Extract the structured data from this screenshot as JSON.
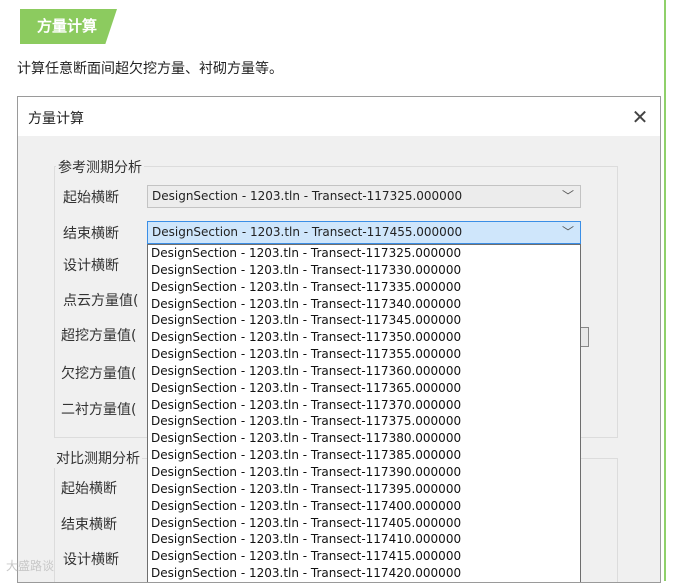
{
  "section_tag": "方量计算",
  "intro": "计算任意断面间超欠挖方量、衬砌方量等。",
  "dialog": {
    "title": "方量计算",
    "close_glyph": "✕",
    "ref_group": {
      "title": "参考测期分析",
      "labels": [
        "起始横断",
        "结束横断",
        "设计横断",
        "点云方量值(",
        "超挖方量值(",
        "欠挖方量值(",
        "二衬方量值("
      ],
      "start_value": "DesignSection - 1203.tln - Transect-117325.000000",
      "end_value": "DesignSection - 1203.tln - Transect-117455.000000"
    },
    "cmp_group": {
      "title": "对比测期分析",
      "labels": [
        "起始横断",
        "结束横断",
        "设计横断"
      ]
    },
    "dropdown_items": [
      "DesignSection - 1203.tln - Transect-117325.000000",
      "DesignSection - 1203.tln - Transect-117330.000000",
      "DesignSection - 1203.tln - Transect-117335.000000",
      "DesignSection - 1203.tln - Transect-117340.000000",
      "DesignSection - 1203.tln - Transect-117345.000000",
      "DesignSection - 1203.tln - Transect-117350.000000",
      "DesignSection - 1203.tln - Transect-117355.000000",
      "DesignSection - 1203.tln - Transect-117360.000000",
      "DesignSection - 1203.tln - Transect-117365.000000",
      "DesignSection - 1203.tln - Transect-117370.000000",
      "DesignSection - 1203.tln - Transect-117375.000000",
      "DesignSection - 1203.tln - Transect-117380.000000",
      "DesignSection - 1203.tln - Transect-117385.000000",
      "DesignSection - 1203.tln - Transect-117390.000000",
      "DesignSection - 1203.tln - Transect-117395.000000",
      "DesignSection - 1203.tln - Transect-117400.000000",
      "DesignSection - 1203.tln - Transect-117405.000000",
      "DesignSection - 1203.tln - Transect-117410.000000",
      "DesignSection - 1203.tln - Transect-117415.000000",
      "DesignSection - 1203.tln - Transect-117420.000000"
    ]
  },
  "watermark": "大盛路谈",
  "icons": {
    "close": "close-icon",
    "dropdown": "chevron-down-icon"
  },
  "colors": {
    "tag_green": "#8ccb5f",
    "selected_combo": "#cfe6fb",
    "selected_border": "#3a8ee6"
  }
}
